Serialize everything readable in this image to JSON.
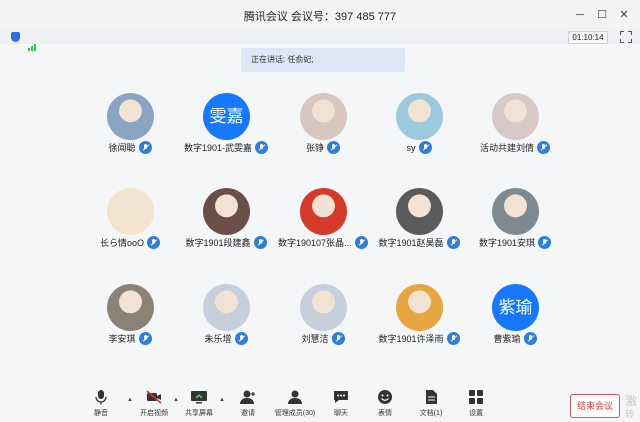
{
  "window": {
    "title": "腾讯会议 会议号：397 485 777",
    "timer": "01:10:14"
  },
  "banner": {
    "speaking": "正在讲话: 任俞妃;"
  },
  "participants": [
    {
      "name": "徐闻聪",
      "avatar": "photo",
      "color": "#8aa5c2"
    },
    {
      "name": "数字1901-武雯嘉",
      "avatar": "text",
      "avatar_text": "雯嘉",
      "color": "#1677ff"
    },
    {
      "name": "张铮",
      "avatar": "photo",
      "color": "#d8c6c0"
    },
    {
      "name": "sy",
      "avatar": "photo",
      "color": "#9cc9de"
    },
    {
      "name": "活动共建刘倩",
      "avatar": "photo",
      "color": "#d7c9c8"
    },
    {
      "name": "长ら情ooO",
      "avatar": "photo",
      "color": "#f3e4cf"
    },
    {
      "name": "数字1901段建鑫",
      "avatar": "photo",
      "color": "#6a4f48"
    },
    {
      "name": "数字190107张晶...",
      "avatar": "photo",
      "color": "#d63a2b"
    },
    {
      "name": "数字1901赵昊磊",
      "avatar": "photo",
      "color": "#5b5b5b"
    },
    {
      "name": "数字1901安琪",
      "avatar": "photo",
      "color": "#7f8a90"
    },
    {
      "name": "李安琪",
      "avatar": "photo",
      "color": "#8b8378"
    },
    {
      "name": "朱乐增",
      "avatar": "photo",
      "color": "#c8cfdc"
    },
    {
      "name": "刘慧洁",
      "avatar": "photo",
      "color": "#c8cfdc"
    },
    {
      "name": "数字1901许泽雨",
      "avatar": "photo",
      "color": "#e8a640"
    },
    {
      "name": "曹紫瑜",
      "avatar": "text",
      "avatar_text": "紫瑜",
      "color": "#1677ff"
    }
  ],
  "toolbar": {
    "mute": "静音",
    "video": "开启视频",
    "share": "共享屏幕",
    "invite": "邀请",
    "members": "管理成员(30)",
    "chat": "聊天",
    "emoji": "表情",
    "docs": "文档(1)",
    "settings": "设置",
    "end": "结束会议"
  },
  "watermark": {
    "line1": "激",
    "line2": "转到"
  },
  "colors": {
    "accent": "#1677ff",
    "end_red": "#e04040",
    "signal": "#2ecc40"
  }
}
